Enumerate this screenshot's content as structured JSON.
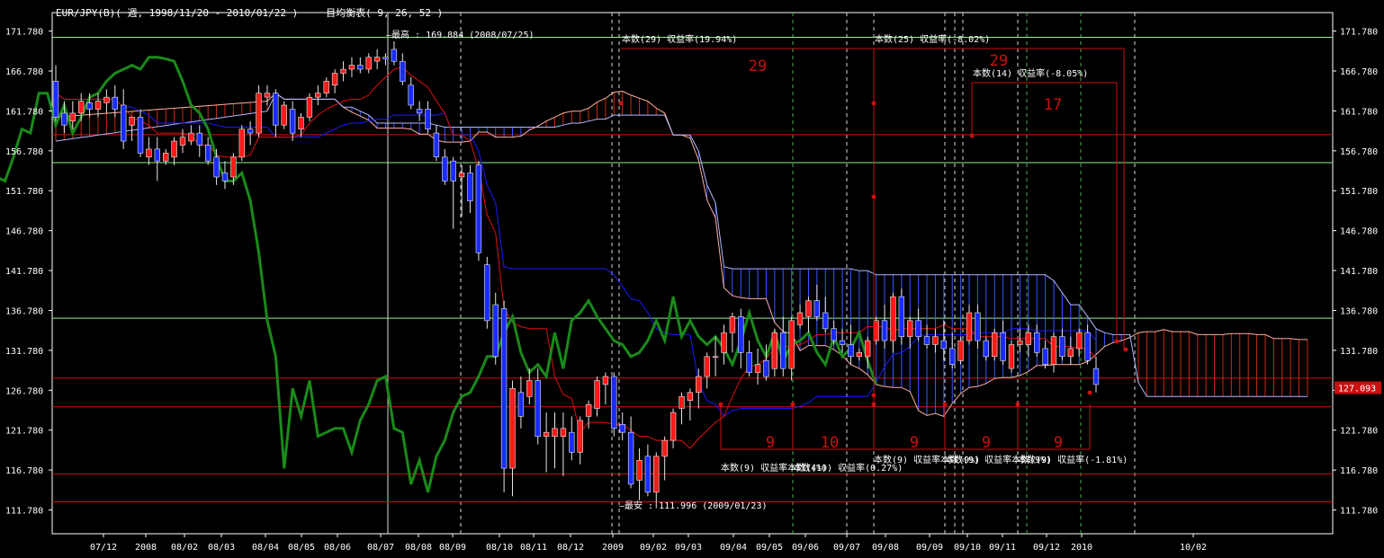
{
  "header": {
    "symbol_line": "EUR/JPY(B)( 週, 1998/11/20 - 2010/01/22 )",
    "indicator": "一目均衡表( 9, 26, 52 )"
  },
  "colors": {
    "background": "#000000",
    "bull": "#ff1a1a",
    "bear": "#1a2cff",
    "kijun": "#1a1aff",
    "tenkan": "#e01010",
    "chikou": "#1a8a1a",
    "span_cloud_red": "#cc2a10",
    "span_cloud_blue": "#3a5aff",
    "hline_green": "#90ee90",
    "hline_red": "#cc1010",
    "price_tag_bg": "#cc1010",
    "annotation": "#cc1010",
    "axis_text": "#ffffff"
  },
  "chart_data": {
    "type": "candlestick",
    "y_ticks": [
      "171.780",
      "166.780",
      "161.780",
      "156.780",
      "151.780",
      "146.780",
      "141.780",
      "136.780",
      "131.780",
      "126.780",
      "121.780",
      "116.780",
      "111.780"
    ],
    "ylim": [
      108.8,
      174.1
    ],
    "x_labels": [
      "07/12",
      "2008",
      "08/02",
      "08/03",
      "08/04",
      "08/05",
      "08/06",
      "08/07",
      "08/08",
      "08/09",
      "08/10",
      "08/11",
      "08/12",
      "2009",
      "09/02",
      "09/03",
      "09/04",
      "09/05",
      "09/06",
      "09/07",
      "09/08",
      "09/09",
      "09/10",
      "09/11",
      "09/12",
      "2010",
      "10/02"
    ],
    "current_price": "127.093",
    "hlines": [
      {
        "value": 171.0,
        "color": "green"
      },
      {
        "value": 158.8,
        "color": "red"
      },
      {
        "value": 155.3,
        "color": "green"
      },
      {
        "value": 135.8,
        "color": "green"
      },
      {
        "value": 128.3,
        "color": "red"
      },
      {
        "value": 124.7,
        "color": "red"
      },
      {
        "value": 116.3,
        "color": "red"
      },
      {
        "value": 112.8,
        "color": "red"
      }
    ],
    "annotations": {
      "high_label": "最高 : 169.884 (2008/07/25)",
      "low_label": "最安 : 111.996 (2009/01/23)",
      "count_boxes_top": [
        {
          "label": "本数(29) 収益率(19.94%)",
          "count": "29"
        },
        {
          "label": "本数(25) 収益率(-8.02%)",
          "count": "29"
        },
        {
          "label": "本数(14) 収益率(-8.05%)",
          "count": "17"
        }
      ],
      "count_boxes_bottom": [
        {
          "label": "本数(9) 収益率本数(4%)",
          "count": "9"
        },
        {
          "label": "本数(10) 収益率(0.27%)",
          "count": "10"
        },
        {
          "label": "本数(9) 収益率本数(9%)",
          "count": "9"
        },
        {
          "label": "本数(9) 収益率本数(9%)",
          "count": "9"
        },
        {
          "label": "本数(9) 収益率(-1.81%)",
          "count": "9"
        }
      ]
    },
    "candles": [
      [
        165.5,
        167.5,
        160.5,
        161.0
      ],
      [
        161.5,
        163.0,
        159.0,
        160.0
      ],
      [
        160.5,
        163.0,
        159.5,
        161.5
      ],
      [
        161.5,
        164.0,
        160.5,
        163.0
      ],
      [
        162.8,
        164.0,
        161.0,
        162.0
      ],
      [
        162.0,
        164.0,
        161.0,
        163.0
      ],
      [
        162.8,
        164.5,
        161.5,
        163.5
      ],
      [
        163.5,
        165.0,
        161.0,
        162.0
      ],
      [
        162.5,
        164.5,
        157.0,
        158.0
      ],
      [
        160.0,
        161.0,
        158.0,
        161.0
      ],
      [
        161.0,
        162.0,
        156.0,
        156.5
      ],
      [
        156.0,
        158.5,
        155.0,
        157.0
      ],
      [
        157.0,
        158.5,
        153.0,
        155.5
      ],
      [
        155.5,
        157.0,
        155.0,
        156.5
      ],
      [
        156.0,
        158.5,
        155.0,
        158.0
      ],
      [
        157.5,
        159.5,
        156.5,
        158.5
      ],
      [
        158.0,
        160.0,
        157.5,
        159.0
      ],
      [
        159.0,
        160.0,
        156.0,
        157.5
      ],
      [
        157.5,
        158.5,
        155.0,
        155.5
      ],
      [
        156.0,
        157.0,
        152.5,
        153.5
      ],
      [
        154.0,
        155.5,
        152.0,
        153.0
      ],
      [
        153.5,
        156.5,
        152.5,
        156.0
      ],
      [
        156.0,
        160.0,
        155.5,
        159.5
      ],
      [
        159.5,
        160.5,
        157.5,
        159.0
      ],
      [
        159.0,
        165.0,
        158.5,
        164.0
      ],
      [
        163.5,
        165.0,
        162.5,
        164.0
      ],
      [
        164.0,
        164.5,
        158.5,
        160.0
      ],
      [
        160.0,
        163.0,
        159.5,
        162.5
      ],
      [
        162.0,
        163.0,
        158.0,
        159.0
      ],
      [
        159.5,
        161.5,
        158.5,
        161.0
      ],
      [
        161.0,
        164.0,
        160.5,
        163.5
      ],
      [
        163.5,
        165.0,
        162.5,
        164.0
      ],
      [
        164.0,
        166.0,
        163.5,
        165.5
      ],
      [
        165.0,
        167.0,
        164.0,
        166.5
      ],
      [
        166.5,
        168.0,
        165.5,
        167.0
      ],
      [
        167.0,
        168.5,
        166.0,
        167.5
      ],
      [
        167.5,
        168.5,
        166.5,
        167.0
      ],
      [
        167.0,
        169.0,
        166.5,
        168.5
      ],
      [
        168.0,
        169.5,
        167.0,
        168.5
      ],
      [
        168.5,
        169.0,
        167.5,
        168.3
      ],
      [
        169.5,
        170.5,
        167.5,
        168.0
      ],
      [
        168.0,
        169.0,
        165.0,
        165.5
      ],
      [
        165.0,
        166.0,
        162.0,
        162.5
      ],
      [
        162.0,
        163.0,
        160.5,
        161.5
      ],
      [
        162.0,
        163.0,
        159.0,
        159.5
      ],
      [
        159.0,
        160.0,
        155.5,
        156.0
      ],
      [
        156.0,
        157.0,
        152.5,
        153.0
      ],
      [
        155.5,
        156.0,
        147.0,
        153.0
      ],
      [
        153.5,
        155.0,
        148.5,
        154.0
      ],
      [
        154.0,
        155.0,
        149.0,
        150.5
      ],
      [
        155.0,
        155.5,
        143.0,
        144.0
      ],
      [
        142.5,
        143.5,
        134.5,
        135.5
      ],
      [
        137.5,
        139.0,
        130.0,
        131.0
      ],
      [
        137.0,
        138.0,
        114.0,
        117.0
      ],
      [
        117.0,
        128.0,
        113.5,
        127.0
      ],
      [
        126.5,
        128.5,
        122.0,
        123.5
      ],
      [
        126.0,
        129.5,
        125.0,
        128.0
      ],
      [
        128.0,
        129.5,
        120.0,
        121.0
      ],
      [
        121.0,
        124.0,
        116.5,
        121.5
      ],
      [
        121.0,
        124.0,
        117.0,
        122.0
      ],
      [
        121.0,
        124.0,
        116.0,
        122.0
      ],
      [
        121.5,
        123.5,
        118.0,
        119.0
      ],
      [
        119.0,
        123.5,
        117.5,
        123.0
      ],
      [
        123.5,
        125.5,
        122.0,
        125.0
      ],
      [
        124.5,
        128.5,
        123.5,
        128.0
      ],
      [
        127.5,
        129.0,
        125.0,
        128.5
      ],
      [
        128.5,
        129.0,
        121.0,
        122.0
      ],
      [
        122.5,
        124.0,
        120.5,
        121.5
      ],
      [
        121.5,
        123.5,
        114.5,
        115.0
      ],
      [
        115.5,
        119.5,
        113.0,
        118.0
      ],
      [
        118.5,
        120.0,
        113.5,
        114.0
      ],
      [
        114.0,
        119.0,
        112.0,
        118.5
      ],
      [
        118.5,
        121.0,
        115.5,
        120.5
      ],
      [
        120.5,
        124.5,
        119.5,
        124.0
      ],
      [
        124.5,
        126.5,
        122.5,
        126.0
      ],
      [
        125.5,
        127.0,
        123.0,
        126.5
      ],
      [
        126.5,
        129.5,
        124.5,
        128.5
      ],
      [
        128.5,
        131.5,
        127.0,
        131.0
      ],
      [
        131.0,
        133.5,
        128.5,
        131.0
      ],
      [
        131.5,
        135.0,
        130.0,
        134.0
      ],
      [
        134.0,
        136.5,
        131.5,
        136.0
      ],
      [
        136.0,
        137.0,
        129.5,
        131.5
      ],
      [
        131.5,
        133.0,
        128.5,
        129.0
      ],
      [
        129.0,
        132.0,
        127.5,
        130.0
      ],
      [
        130.5,
        132.5,
        128.0,
        128.5
      ],
      [
        129.5,
        134.5,
        128.5,
        134.0
      ],
      [
        134.0,
        136.0,
        128.5,
        129.5
      ],
      [
        129.5,
        136.0,
        128.0,
        135.5
      ],
      [
        135.0,
        137.5,
        134.5,
        136.5
      ],
      [
        136.0,
        138.5,
        134.0,
        138.0
      ],
      [
        138.0,
        140.0,
        135.5,
        136.0
      ],
      [
        136.5,
        138.5,
        134.0,
        134.5
      ],
      [
        134.5,
        135.5,
        132.5,
        133.0
      ],
      [
        133.0,
        134.5,
        131.5,
        132.5
      ],
      [
        132.5,
        135.0,
        130.0,
        131.0
      ],
      [
        131.0,
        132.0,
        130.5,
        131.5
      ],
      [
        131.0,
        133.5,
        129.5,
        133.0
      ],
      [
        133.0,
        136.0,
        132.5,
        135.5
      ],
      [
        135.5,
        137.5,
        132.0,
        133.0
      ],
      [
        133.0,
        139.0,
        131.5,
        138.5
      ],
      [
        138.5,
        139.5,
        132.5,
        133.5
      ],
      [
        133.5,
        136.0,
        132.0,
        135.5
      ],
      [
        135.5,
        137.0,
        133.0,
        133.5
      ],
      [
        133.5,
        135.0,
        132.0,
        132.5
      ],
      [
        132.5,
        134.5,
        131.5,
        133.5
      ],
      [
        133.0,
        135.5,
        130.5,
        132.0
      ],
      [
        132.0,
        134.0,
        129.5,
        130.0
      ],
      [
        130.5,
        133.5,
        130.0,
        133.0
      ],
      [
        133.0,
        137.5,
        132.5,
        136.5
      ],
      [
        136.5,
        137.5,
        132.0,
        133.0
      ],
      [
        133.0,
        133.5,
        130.5,
        131.0
      ],
      [
        131.0,
        134.5,
        130.5,
        134.0
      ],
      [
        134.0,
        135.5,
        130.0,
        130.5
      ],
      [
        129.5,
        133.0,
        129.0,
        132.5
      ],
      [
        132.5,
        134.5,
        131.5,
        133.0
      ],
      [
        132.5,
        135.0,
        131.0,
        134.0
      ],
      [
        134.0,
        135.0,
        131.0,
        131.5
      ],
      [
        132.0,
        133.0,
        129.5,
        130.0
      ],
      [
        130.0,
        134.0,
        129.0,
        133.5
      ],
      [
        133.5,
        134.5,
        130.5,
        131.0
      ],
      [
        131.0,
        133.5,
        130.0,
        132.0
      ],
      [
        132.0,
        134.5,
        131.0,
        134.0
      ],
      [
        134.0,
        135.0,
        130.0,
        130.5
      ],
      [
        129.5,
        131.0,
        126.5,
        127.5
      ]
    ]
  }
}
